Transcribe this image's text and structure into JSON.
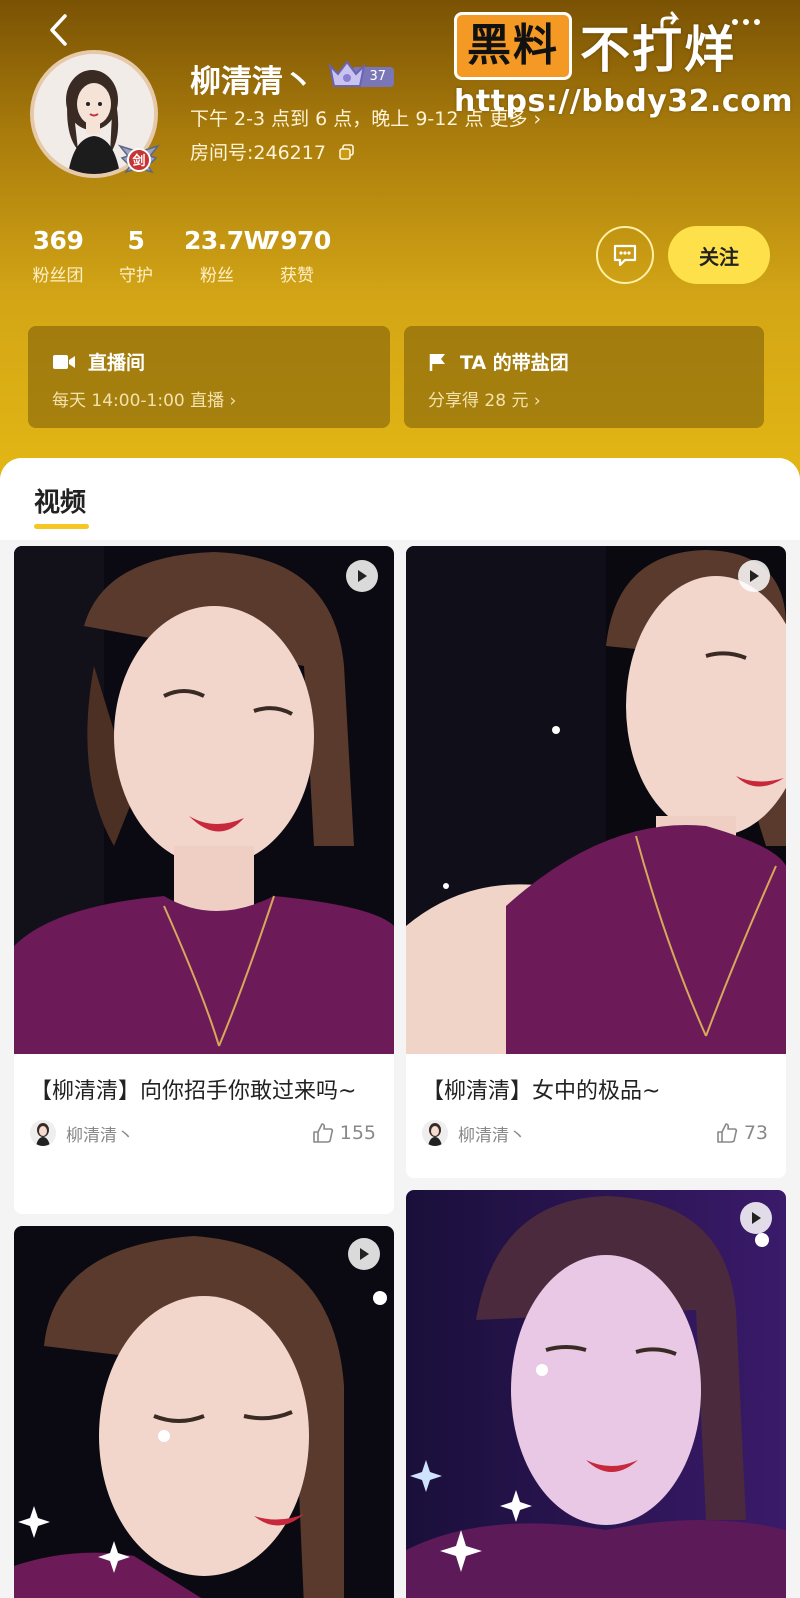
{
  "watermark": {
    "badge": "黑料",
    "text": "不打烊",
    "url": "https://bbdy32.com"
  },
  "profile": {
    "name": "柳清清丶",
    "level": "37",
    "avatar_badge": "剑",
    "schedule": "下午 2-3 点到 6 点，晚上 9-12 点  更多 ›",
    "room": "房间号:246217"
  },
  "stats": [
    {
      "num": "369",
      "label": "粉丝团"
    },
    {
      "num": "5",
      "label": "守护"
    },
    {
      "num": "23.7W",
      "label": "粉丝"
    },
    {
      "num": "7970",
      "label": "获赞"
    }
  ],
  "actions": {
    "follow": "关注"
  },
  "cards": {
    "live": {
      "title": "直播间",
      "sub": "每天 14:00-1:00 直播 ›"
    },
    "team": {
      "title": "TA 的带盐团",
      "sub": "分享得 28 元 ›"
    }
  },
  "tabs": [
    {
      "label": "视频"
    }
  ],
  "videos": [
    {
      "title": "【柳清清】向你招手你敢过来吗~",
      "author": "柳清清丶",
      "likes": "155"
    },
    {
      "title": "【柳清清】女中的极品~",
      "author": "柳清清丶",
      "likes": "73"
    },
    {
      "title": "",
      "author": "",
      "likes": ""
    },
    {
      "title": "",
      "author": "",
      "likes": ""
    }
  ],
  "colors": {
    "accent": "#f6c623",
    "follow_bg": "#fee04b",
    "header_top": "#7a5204",
    "header_bottom": "#e2b714"
  }
}
